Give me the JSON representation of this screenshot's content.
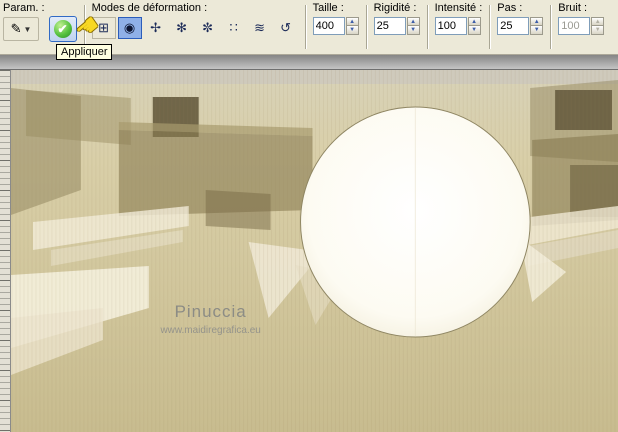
{
  "toolbar": {
    "param": {
      "label": "Param. :",
      "preset_icon": "✎",
      "dropdown_glyph": "▼"
    },
    "apply": {
      "tooltip": "Appliquer",
      "check_glyph": "✔"
    },
    "cursor": {
      "glyph": "☚"
    },
    "modes": {
      "label": "Modes de déformation :",
      "buttons": [
        {
          "name": "push",
          "glyph": "⊞",
          "selected": false
        },
        {
          "name": "expand",
          "glyph": "◉",
          "selected": true
        },
        {
          "name": "contract",
          "glyph": "✢",
          "selected": false
        },
        {
          "name": "right-twirl",
          "glyph": "✻",
          "selected": false
        },
        {
          "name": "left-twirl",
          "glyph": "✼",
          "selected": false
        },
        {
          "name": "noise",
          "glyph": "∷",
          "selected": false
        },
        {
          "name": "iron-out",
          "glyph": "≋",
          "selected": false
        },
        {
          "name": "unwarp",
          "glyph": "↺",
          "selected": false
        }
      ]
    },
    "fields": [
      {
        "label": "Taille :",
        "value": "400",
        "disabled": false
      },
      {
        "label": "Rigidité :",
        "value": "25",
        "disabled": false
      },
      {
        "label": "Intensité :",
        "value": "100",
        "disabled": false
      },
      {
        "label": "Pas :",
        "value": "25",
        "disabled": false
      },
      {
        "label": "Bruit :",
        "value": "100",
        "disabled": true
      }
    ]
  },
  "canvas": {
    "watermark_title": "Pinuccia",
    "watermark_url": "www.maidiregrafica.eu"
  },
  "colors": {
    "toolbar_bg": "#ece9d8",
    "selection_blue": "#316ac5",
    "canvas_base": "#d7cda6",
    "circle_fill": "#fefdf8",
    "tooltip_bg": "#ffffe1"
  }
}
